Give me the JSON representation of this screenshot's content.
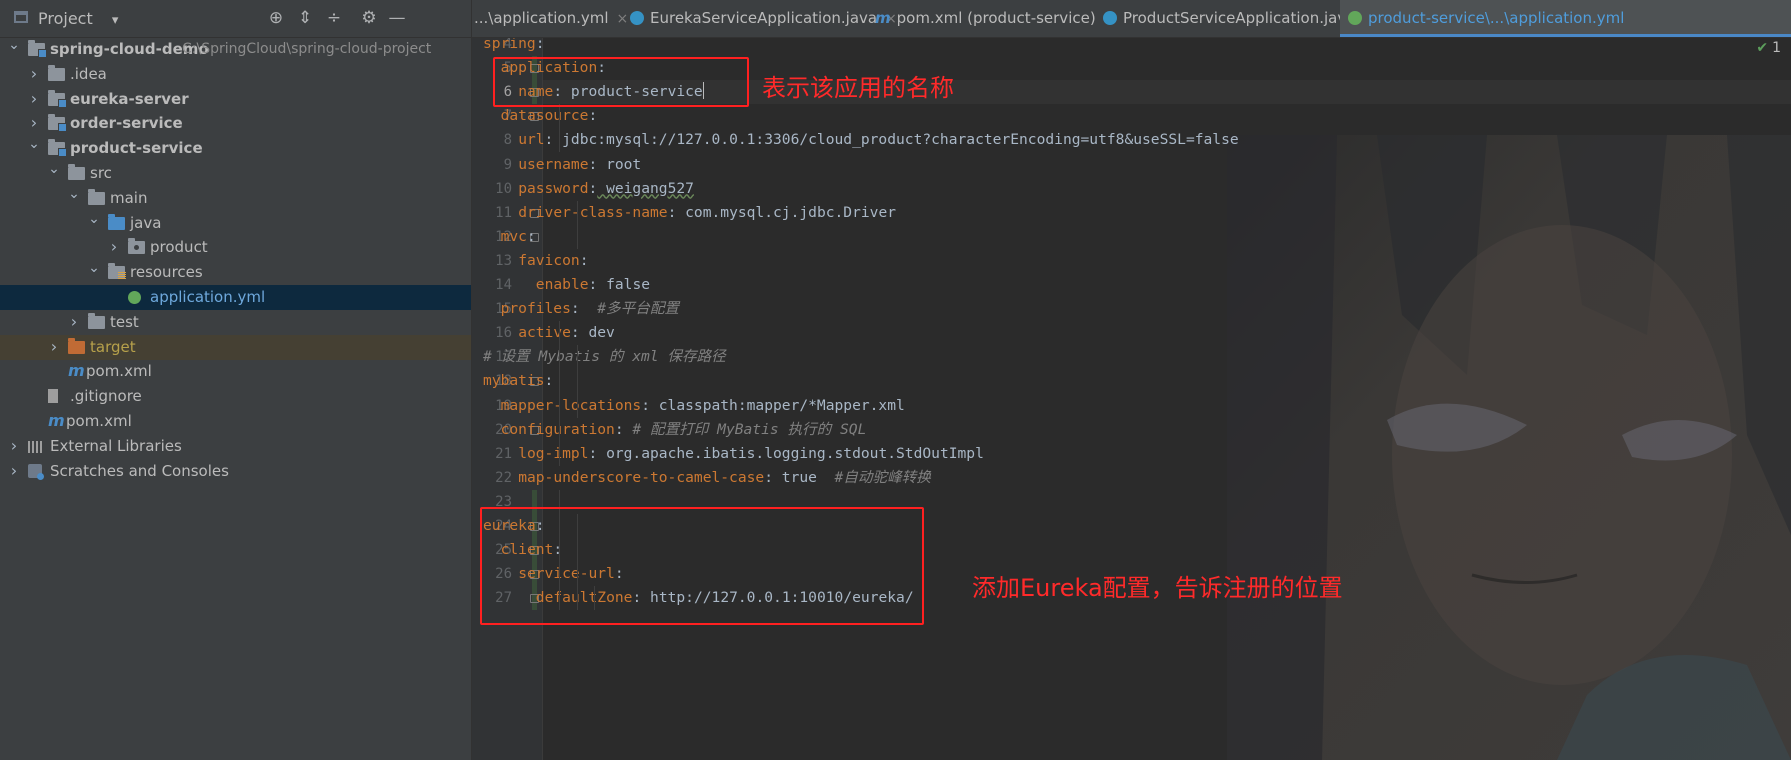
{
  "project_panel": {
    "title": "Project",
    "dropdown_glyph": "▾",
    "toolbar_icons": [
      "locate-icon",
      "expand-all-icon",
      "collapse-all-icon",
      "settings-icon",
      "hide-icon"
    ]
  },
  "tree": [
    {
      "label": "spring-cloud-demo",
      "suffix": "C:\\SpringCloud\\spring-cloud-project",
      "depth": 0,
      "arrow": "expanded",
      "icon": "module-folder",
      "bold": true
    },
    {
      "label": ".idea",
      "depth": 1,
      "arrow": "collapsed",
      "icon": "folder"
    },
    {
      "label": "eureka-server",
      "depth": 1,
      "arrow": "collapsed",
      "icon": "module-folder",
      "bold": true
    },
    {
      "label": "order-service",
      "depth": 1,
      "arrow": "collapsed",
      "icon": "module-folder",
      "bold": true
    },
    {
      "label": "product-service",
      "depth": 1,
      "arrow": "expanded",
      "icon": "module-folder",
      "bold": true
    },
    {
      "label": "src",
      "depth": 2,
      "arrow": "expanded",
      "icon": "folder"
    },
    {
      "label": "main",
      "depth": 3,
      "arrow": "expanded",
      "icon": "folder"
    },
    {
      "label": "java",
      "depth": 4,
      "arrow": "expanded",
      "icon": "source-folder"
    },
    {
      "label": "product",
      "depth": 5,
      "arrow": "collapsed",
      "icon": "package"
    },
    {
      "label": "resources",
      "depth": 4,
      "arrow": "expanded",
      "icon": "resources-folder"
    },
    {
      "label": "application.yml",
      "depth": 5,
      "arrow": "none",
      "icon": "yaml-file",
      "selected": true
    },
    {
      "label": "test",
      "depth": 3,
      "arrow": "collapsed",
      "icon": "folder"
    },
    {
      "label": "target",
      "depth": 2,
      "arrow": "collapsed",
      "icon": "excluded-folder",
      "highlight": true
    },
    {
      "label": "pom.xml",
      "depth": 2,
      "arrow": "none",
      "icon": "maven-file"
    },
    {
      "label": ".gitignore",
      "depth": 1,
      "arrow": "none",
      "icon": "gitignore-file"
    },
    {
      "label": "pom.xml",
      "depth": 1,
      "arrow": "none",
      "icon": "maven-file"
    },
    {
      "label": "External Libraries",
      "depth": 0,
      "arrow": "collapsed",
      "icon": "libraries"
    },
    {
      "label": "Scratches and Consoles",
      "depth": 0,
      "arrow": "collapsed",
      "icon": "scratches"
    }
  ],
  "tabs": [
    {
      "label": "...\\application.yml",
      "icon": "none",
      "active": false
    },
    {
      "label": "EurekaServiceApplication.java",
      "icon": "class",
      "active": false
    },
    {
      "label": "pom.xml (product-service)",
      "icon": "maven",
      "active": false
    },
    {
      "label": "ProductServiceApplication.java",
      "icon": "class",
      "active": false
    },
    {
      "label": "product-service\\...\\application.yml",
      "icon": "yaml",
      "active": true
    }
  ],
  "tab_close_glyph": "×",
  "editor": {
    "inspection_count": "1",
    "lines": [
      {
        "n": "4",
        "indent": 0,
        "key": "spring",
        "sep": ":",
        "value": "",
        "comment": ""
      },
      {
        "n": "5",
        "indent": 1,
        "key": "application",
        "sep": ":",
        "value": "",
        "comment": ""
      },
      {
        "n": "6",
        "indent": 2,
        "key": "name",
        "sep": ":",
        "value": " product-service",
        "comment": "",
        "caret": true
      },
      {
        "n": "7",
        "indent": 1,
        "key": "datasource",
        "sep": ":",
        "value": "",
        "comment": ""
      },
      {
        "n": "8",
        "indent": 2,
        "key": "url",
        "sep": ":",
        "value": " jdbc:mysql://127.0.0.1:3306/cloud_product?characterEncoding=utf8&useSSL=false",
        "comment": ""
      },
      {
        "n": "9",
        "indent": 2,
        "key": "username",
        "sep": ":",
        "value": " root",
        "comment": ""
      },
      {
        "n": "10",
        "indent": 2,
        "key": "password",
        "sep": ":",
        "value": " weigang527",
        "comment": "",
        "squiggle": true
      },
      {
        "n": "11",
        "indent": 2,
        "key": "driver-class-name",
        "sep": ":",
        "value": " com.mysql.cj.jdbc.Driver",
        "comment": ""
      },
      {
        "n": "12",
        "indent": 1,
        "key": "mvc",
        "sep": ":",
        "value": "",
        "comment": ""
      },
      {
        "n": "13",
        "indent": 2,
        "key": "favicon",
        "sep": ":",
        "value": "",
        "comment": ""
      },
      {
        "n": "14",
        "indent": 3,
        "key": "enable",
        "sep": ":",
        "value": " false",
        "comment": ""
      },
      {
        "n": "15",
        "indent": 1,
        "key": "profiles",
        "sep": ":",
        "value": "  ",
        "comment": "#多平台配置"
      },
      {
        "n": "16",
        "indent": 2,
        "key": "active",
        "sep": ":",
        "value": " dev",
        "comment": ""
      },
      {
        "n": "17",
        "indent": 0,
        "key": "",
        "sep": "",
        "value": "",
        "comment": "# 设置 Mybatis 的 xml 保存路径"
      },
      {
        "n": "18",
        "indent": 0,
        "key": "mybatis",
        "sep": ":",
        "value": "",
        "comment": ""
      },
      {
        "n": "19",
        "indent": 1,
        "key": "mapper-locations",
        "sep": ":",
        "value": " classpath:mapper/*Mapper.xml",
        "comment": ""
      },
      {
        "n": "20",
        "indent": 1,
        "key": "configuration",
        "sep": ":",
        "value": " ",
        "comment": "# 配置打印 MyBatis 执行的 SQL"
      },
      {
        "n": "21",
        "indent": 2,
        "key": "log-impl",
        "sep": ":",
        "value": " org.apache.ibatis.logging.stdout.StdOutImpl",
        "comment": ""
      },
      {
        "n": "22",
        "indent": 2,
        "key": "map-underscore-to-camel-case",
        "sep": ":",
        "value": " true  ",
        "comment": "#自动驼峰转换"
      },
      {
        "n": "23",
        "indent": 0,
        "key": "",
        "sep": "",
        "value": "",
        "comment": ""
      },
      {
        "n": "24",
        "indent": 0,
        "key": "eureka",
        "sep": ":",
        "value": "",
        "comment": ""
      },
      {
        "n": "25",
        "indent": 1,
        "key": "client",
        "sep": ":",
        "value": "",
        "comment": ""
      },
      {
        "n": "26",
        "indent": 2,
        "key": "service-url",
        "sep": ":",
        "value": "",
        "comment": ""
      },
      {
        "n": "27",
        "indent": 3,
        "key": "defaultZone",
        "sep": ":",
        "value": " http://127.0.0.1:10010/eureka/",
        "comment": ""
      }
    ]
  },
  "annotations": {
    "app_name_note": "表示该应用的名称",
    "eureka_note": "添加Eureka配置，告诉注册的位置",
    "color": "#ff2020"
  },
  "colors": {
    "yaml_key": "#cc7832",
    "value": "#a9b7c6",
    "comment": "#808080",
    "active_tab_text": "#4f9ddc",
    "selection": "#0d293e"
  }
}
